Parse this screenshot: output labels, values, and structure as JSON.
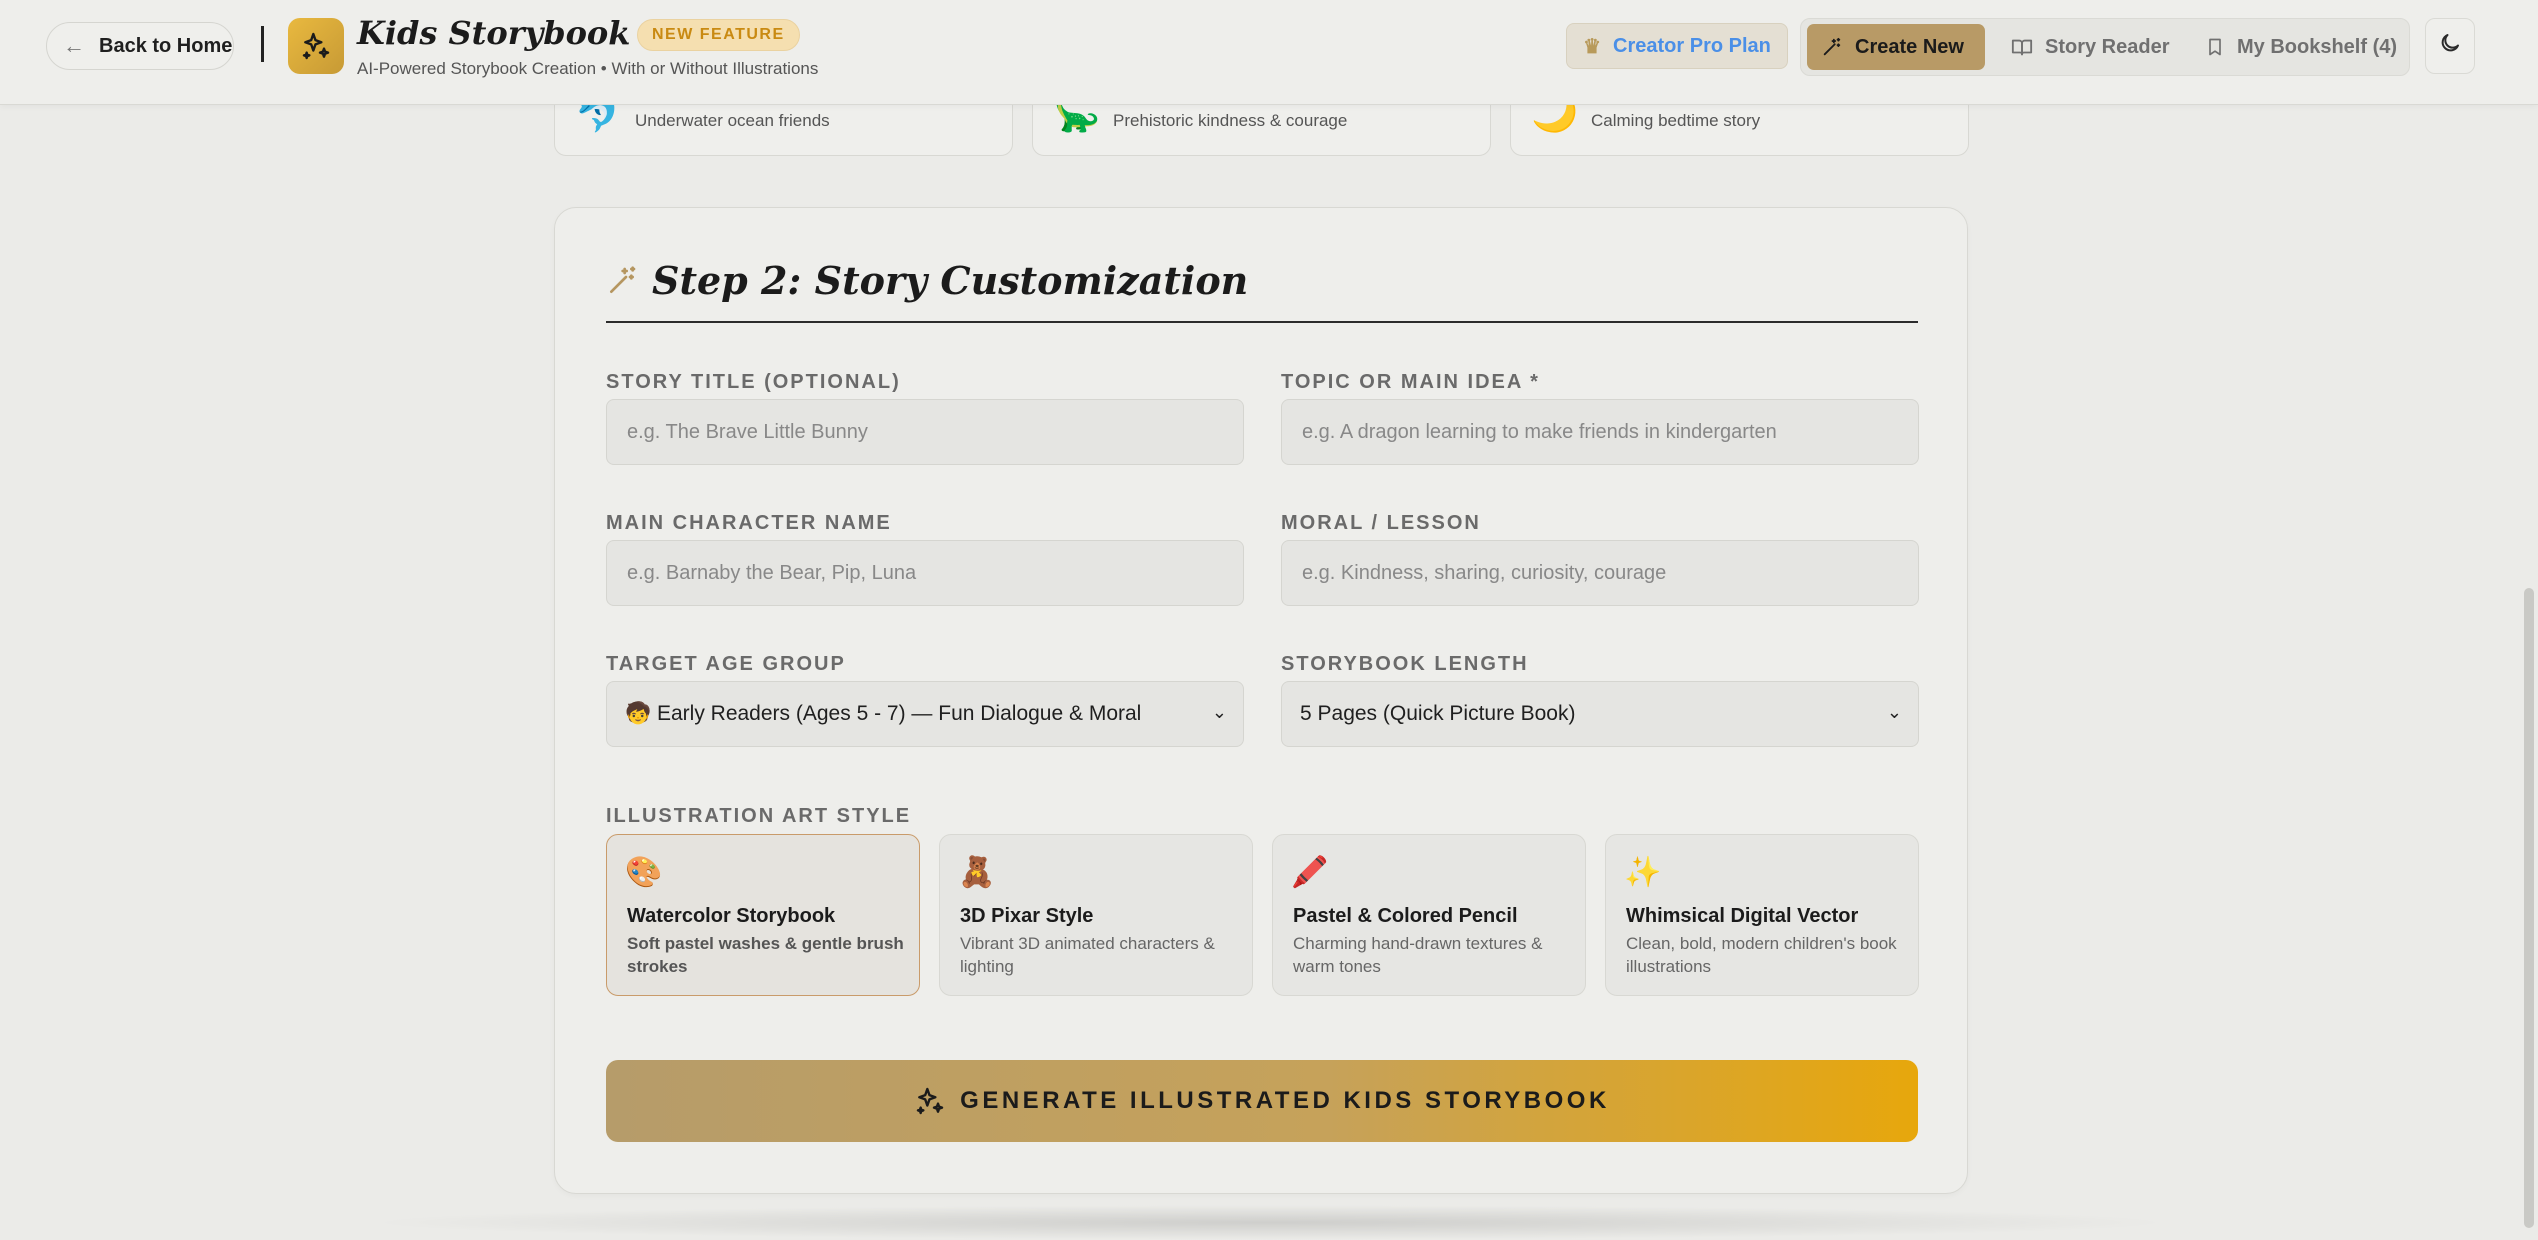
{
  "header": {
    "back_label": "Back to Home",
    "app_title": "Kids Storybook Studio",
    "badge": "NEW FEATURE",
    "subtitle": "AI-Powered Storybook Creation • With or Without Illustrations",
    "pro_plan": "Creator Pro Plan",
    "nav": {
      "create_new": "Create New",
      "story_reader": "Story Reader",
      "bookshelf": "My Bookshelf (4)"
    }
  },
  "themes": [
    {
      "emoji": "🐬",
      "desc": "Underwater ocean friends"
    },
    {
      "emoji": "🦕",
      "desc": "Prehistoric kindness & courage"
    },
    {
      "emoji": "🌙",
      "desc": "Calming bedtime story"
    }
  ],
  "form": {
    "step_title": "Step 2: Story Customization",
    "title_label": "STORY TITLE (OPTIONAL)",
    "title_placeholder": "e.g. The Brave Little Bunny",
    "topic_label": "TOPIC OR MAIN IDEA *",
    "topic_placeholder": "e.g. A dragon learning to make friends in kindergarten",
    "character_label": "MAIN CHARACTER NAME",
    "character_placeholder": "e.g. Barnaby the Bear, Pip, Luna",
    "moral_label": "MORAL / LESSON",
    "moral_placeholder": "e.g. Kindness, sharing, curiosity, courage",
    "age_label": "TARGET AGE GROUP",
    "age_value": "🧒 Early Readers (Ages 5 - 7) — Fun Dialogue & Moral",
    "length_label": "STORYBOOK LENGTH",
    "length_value": "5 Pages (Quick Picture Book)",
    "art_label": "ILLUSTRATION ART STYLE",
    "styles": [
      {
        "emoji": "🎨",
        "name": "Watercolor Storybook",
        "desc": "Soft pastel washes & gentle brush strokes"
      },
      {
        "emoji": "🧸",
        "name": "3D Pixar Style",
        "desc": "Vibrant 3D animated characters & lighting"
      },
      {
        "emoji": "🖍️",
        "name": "Pastel & Colored Pencil",
        "desc": "Charming hand-drawn textures & warm tones"
      },
      {
        "emoji": "✨",
        "name": "Whimsical Digital Vector",
        "desc": "Clean, bold, modern children's book illustrations"
      }
    ],
    "generate_label": "GENERATE ILLUSTRATED KIDS STORYBOOK"
  },
  "colors": {
    "accent": "#b89a66",
    "accent_gold": "#e7a70c",
    "link_blue": "#4a8fe7"
  }
}
